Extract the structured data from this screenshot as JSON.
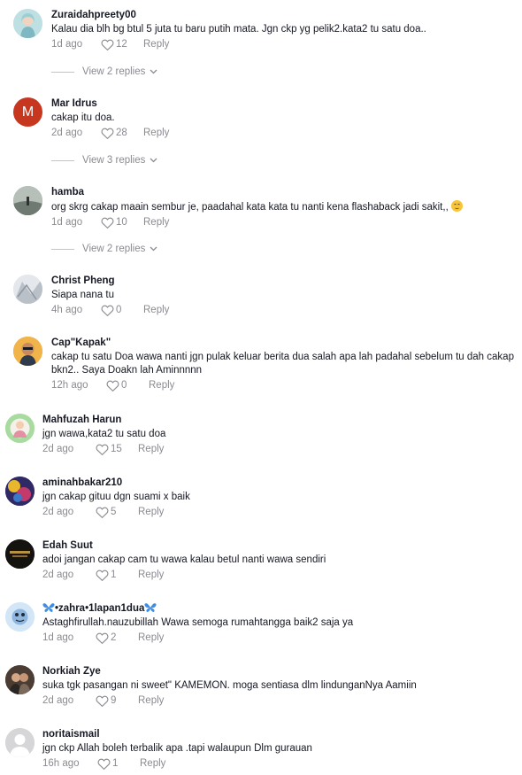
{
  "comments": [
    {
      "username": "Zuraidahpreety00",
      "text": "Kalau dia blh bg btul 5 juta tu baru putih mata. Jgn ckp yg pelik2.kata2 tu satu doa..",
      "age": "1d ago",
      "likes": "12",
      "reply": "Reply",
      "view_replies": "View 2 replies"
    },
    {
      "username": "Mar Idrus",
      "avatar_letter": "M",
      "text": "cakap itu doa.",
      "age": "2d ago",
      "likes": "28",
      "reply": "Reply",
      "view_replies": "View 3 replies"
    },
    {
      "username": "hamba",
      "text": "org skrg cakap maain sembur je, paadahal kata kata tu nanti kena flashaback jadi sakit,,",
      "age": "1d ago",
      "likes": "10",
      "reply": "Reply",
      "view_replies": "View 2 replies"
    },
    {
      "username": "Christ Pheng",
      "text": "Siapa nana tu",
      "age": "4h ago",
      "likes": "0",
      "reply": "Reply"
    },
    {
      "username": "Cap\"Kapak\"",
      "text": "cakap tu satu Doa wawa nanti jgn pulak keluar berita dua salah apa lah padahal sebelum tu dah cakap bkn2.. Saya Doakn lah Aminnnnn",
      "age": "12h ago",
      "likes": "0",
      "reply": "Reply"
    },
    {
      "username": "Mahfuzah Harun",
      "text": "jgn wawa,kata2 tu satu doa",
      "age": "2d ago",
      "likes": "15",
      "reply": "Reply"
    },
    {
      "username": "aminahbakar210",
      "text": "jgn cakap gituu dgn suami x baik",
      "age": "2d ago",
      "likes": "5",
      "reply": "Reply"
    },
    {
      "username": "Edah Suut",
      "text": "adoi jangan cakap cam tu wawa kalau betul nanti wawa sendiri",
      "age": "2d ago",
      "likes": "1",
      "reply": "Reply"
    },
    {
      "username": "•zahra•1lapan1dua",
      "text": "Astaghfirullah.nauzubillah Wawa semoga rumahtangga baik2 saja ya",
      "age": "1d ago",
      "likes": "2",
      "reply": "Reply"
    },
    {
      "username": "Norkiah Zye",
      "text": "suka tgk pasangan ni sweet\" KAMEMON. moga sentiasa dlm lindunganNya Aamiin",
      "age": "2d ago",
      "likes": "9",
      "reply": "Reply"
    },
    {
      "username": "noritaismail",
      "text": "jgn ckp Allah boleh terbalik apa .tapi walaupun Dlm gurauan",
      "age": "16h ago",
      "likes": "1",
      "reply": "Reply"
    }
  ],
  "colors": {
    "text": "#161823",
    "muted": "#8a8b91",
    "mar_idrus_avatar": "#c7361f"
  }
}
